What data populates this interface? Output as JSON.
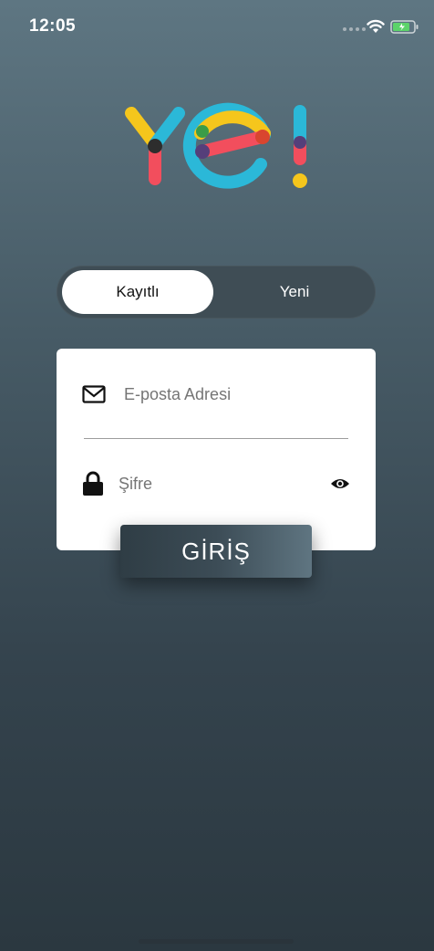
{
  "status_bar": {
    "time": "12:05"
  },
  "logo": {
    "text": "Ye!",
    "colors": [
      "#f5c61c",
      "#2bb8d8",
      "#f24e5d",
      "#3b9c48",
      "#553f7a"
    ]
  },
  "segment": {
    "active_label": "Kayıtlı",
    "inactive_label": "Yeni"
  },
  "form": {
    "email_placeholder": "E-posta Adresi",
    "password_placeholder": "Şifre"
  },
  "login_button": {
    "label": "GİRİŞ"
  },
  "icons": {
    "email": "envelope-icon",
    "password": "lock-icon",
    "show_password": "eye-icon"
  }
}
